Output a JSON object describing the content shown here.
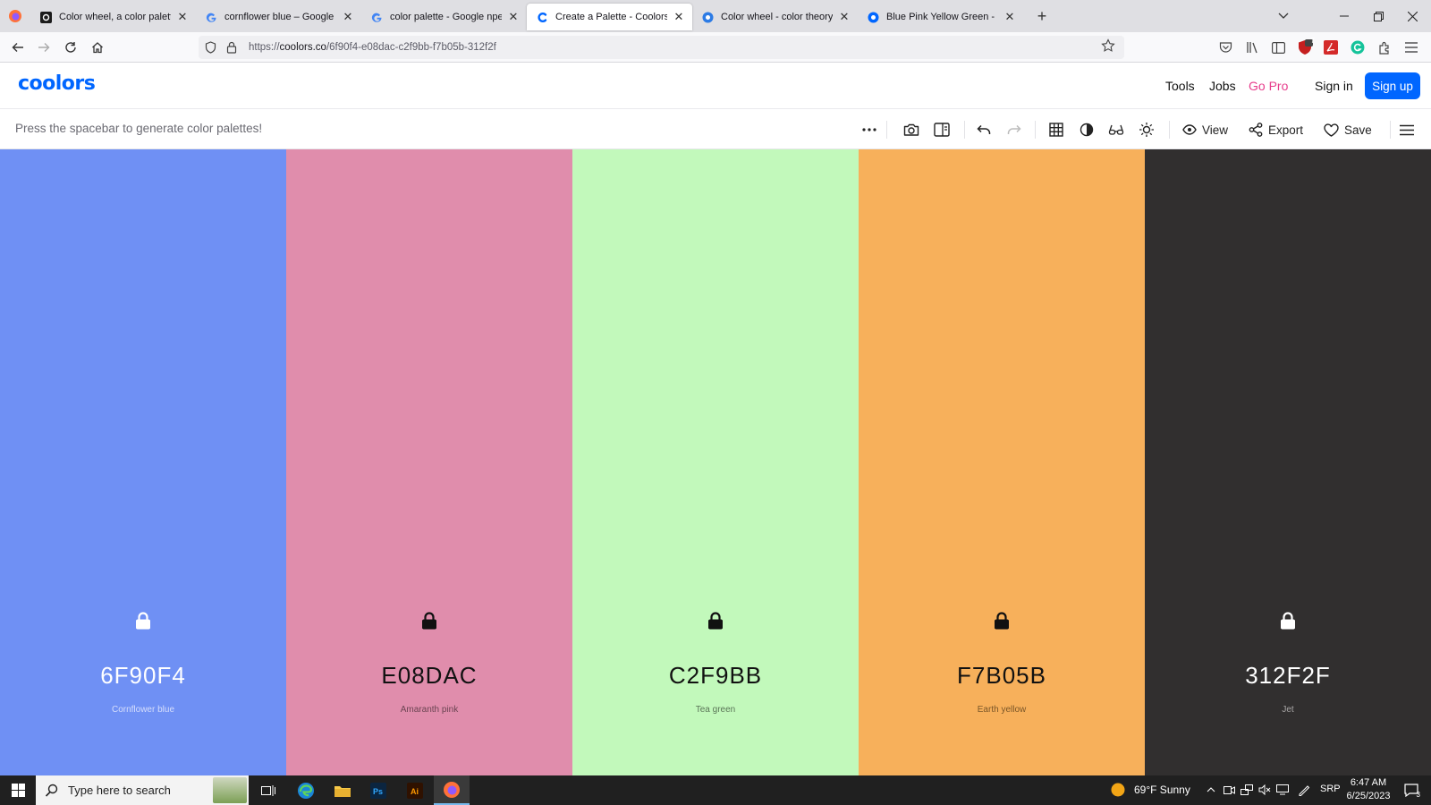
{
  "browser": {
    "tabs": [
      {
        "title": "Color wheel, a color palette generator",
        "icon": "canva-favicon-icon"
      },
      {
        "title": "cornflower blue – Google npetpara",
        "icon": "google-favicon-icon"
      },
      {
        "title": "color palette - Google nperpara",
        "icon": "google-favicon-icon"
      },
      {
        "title": "Create a Palette - Coolors",
        "icon": "coolors-favicon-icon",
        "active": true
      },
      {
        "title": "Color wheel - color theory and calculator",
        "icon": "colorwheel-favicon-icon"
      },
      {
        "title": "Blue Pink Yellow Green - Free & Simple",
        "icon": "coolors-favicon-icon"
      }
    ],
    "url_prefix": "https://",
    "url_domain": "coolors.co",
    "url_path": "/6f90f4-e08dac-c2f9bb-f7b05b-312f2f",
    "extension_badge": "7"
  },
  "site": {
    "brand": "coolors",
    "nav": {
      "tools": "Tools",
      "jobs": "Jobs",
      "gopro": "Go Pro",
      "signin": "Sign in",
      "signup": "Sign up"
    },
    "accent": "#0066ff",
    "pro_color": "#e73d8c"
  },
  "toolbar": {
    "hint": "Press the spacebar to generate color palettes!",
    "view": "View",
    "export": "Export",
    "save": "Save"
  },
  "palette": [
    {
      "hex": "6F90F4",
      "name": "Cornflower blue",
      "color": "#6F90F4",
      "text_color": "#ffffff",
      "name_color": "#d6defc",
      "locked": false
    },
    {
      "hex": "E08DAC",
      "name": "Amaranth pink",
      "color": "#E08DAC",
      "text_color": "#111111",
      "name_color": "#6b4452",
      "locked": true
    },
    {
      "hex": "C2F9BB",
      "name": "Tea green",
      "color": "#C2F9BB",
      "text_color": "#111111",
      "name_color": "#5a7557",
      "locked": true
    },
    {
      "hex": "F7B05B",
      "name": "Earth yellow",
      "color": "#F7B05B",
      "text_color": "#111111",
      "name_color": "#7a5628",
      "locked": true
    },
    {
      "hex": "312F2F",
      "name": "Jet",
      "color": "#312F2F",
      "text_color": "#ffffff",
      "name_color": "#a8a6a6",
      "locked": false
    }
  ],
  "taskbar": {
    "search_placeholder": "Type here to search",
    "weather": "69°F  Sunny",
    "lang": "SRP",
    "time": "6:47 AM",
    "date": "6/25/2023",
    "notifications": "3"
  }
}
